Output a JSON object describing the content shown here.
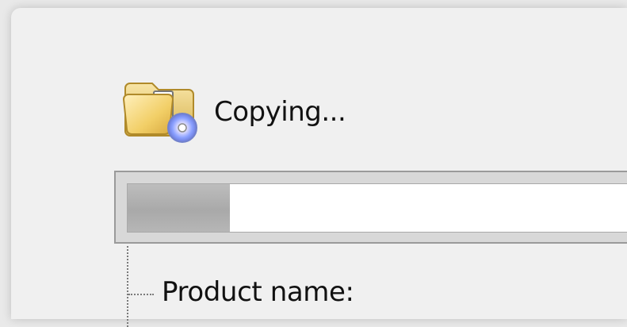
{
  "dialog": {
    "status_text": "Copying...",
    "progress_fraction": 0.2,
    "product_label": "Product name:"
  },
  "icons": {
    "status_icon": "folder-with-disc-icon"
  },
  "colors": {
    "background": "#f0f0f0",
    "progress_fill": "#aaaaaa",
    "progress_track": "#ffffff"
  }
}
